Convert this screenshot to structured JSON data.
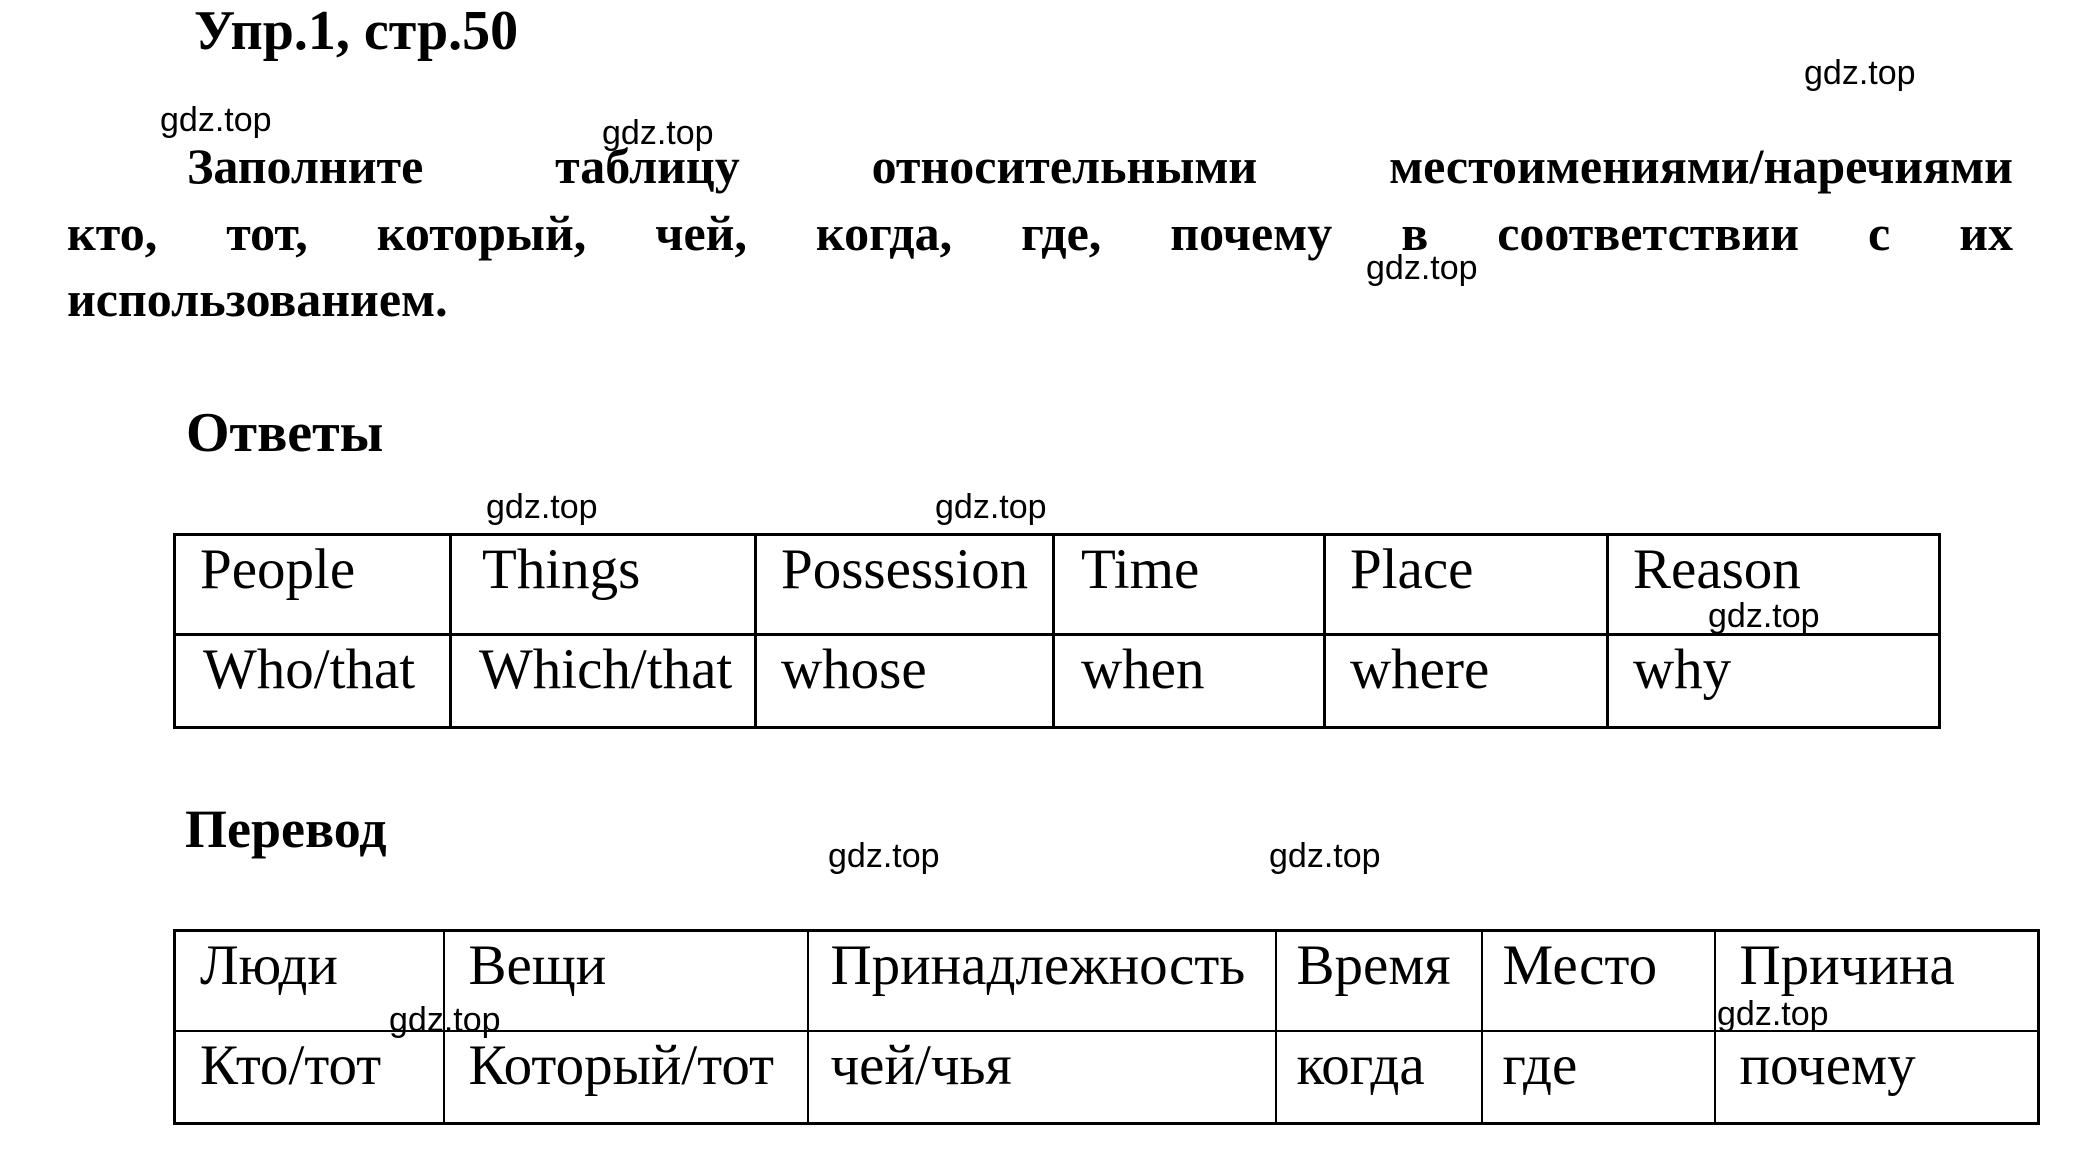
{
  "title": "Упр.1, стр.50",
  "instruction": {
    "lines": [
      "Заполните таблицу относительными местоимениями/наречиями",
      "кто, тот, который, чей, когда, где, почему в соответствии с их",
      "использованием."
    ]
  },
  "answers": {
    "heading": "Ответы",
    "table": {
      "header": [
        "People",
        "Things",
        "Possession",
        "Time",
        "Place",
        "Reason"
      ],
      "row": [
        "Who/that",
        "Which/that",
        "whose",
        "when",
        "where",
        "why"
      ]
    }
  },
  "translation": {
    "heading": "Перевод",
    "table": {
      "header": [
        "Люди",
        "Вещи",
        "Принадлежность",
        "Время",
        "Место",
        "Причина"
      ],
      "row": [
        "Кто/тот",
        "Который/тот",
        "чей/чья",
        "когда",
        "где",
        "почему"
      ]
    }
  },
  "watermark": "gdz.top"
}
